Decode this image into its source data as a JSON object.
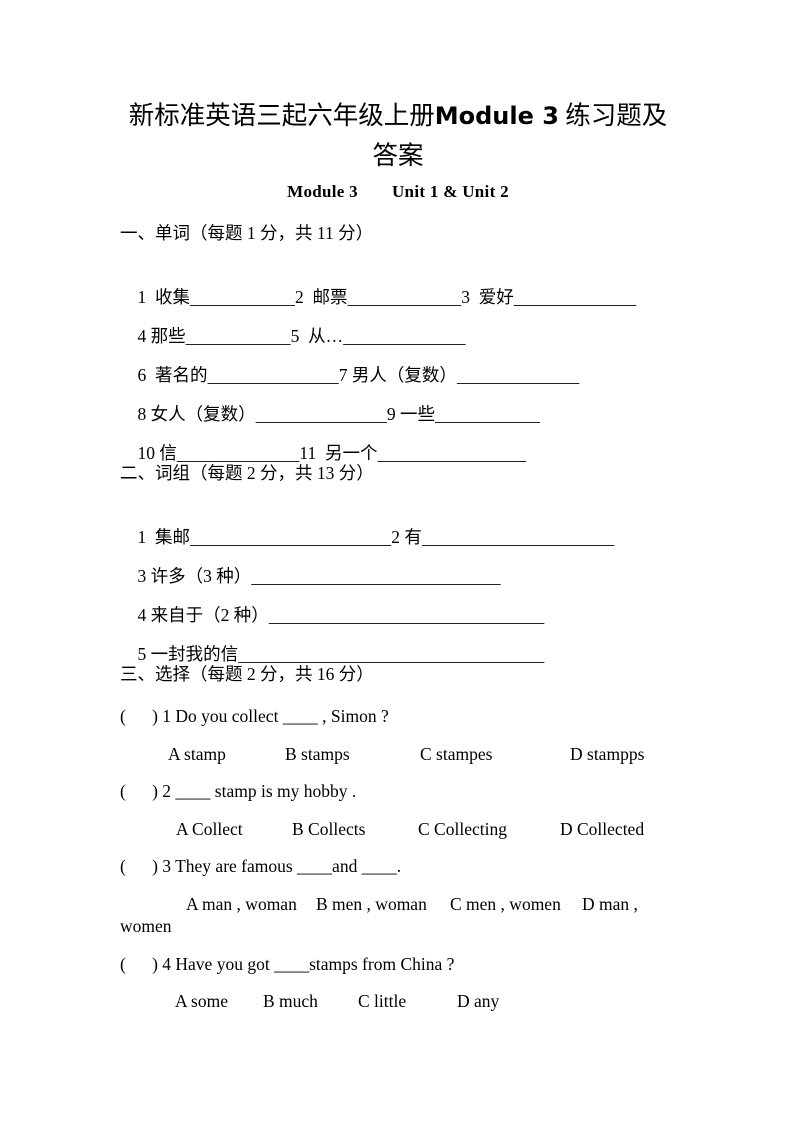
{
  "document": {
    "title_before": "新标准英语三起六年级上册 ",
    "title_bold": "Module 3",
    "title_after": " 练习题及答案",
    "title_line1": "新标准英语三起六年级上册",
    "title_line2": "案",
    "subtitle_left": "Module 3",
    "subtitle_right": "Unit 1 & Unit 2"
  },
  "section1": {
    "heading": "一、单词（每题 1 分，共 11 分）",
    "rows": [
      {
        "items": [
          {
            "label": "1  收集",
            "blank": "____________"
          },
          {
            "label": "2  邮票",
            "blank": "_____________"
          },
          {
            "label": "3  爱好",
            "blank": "______________"
          }
        ]
      },
      {
        "items": [
          {
            "label": "4 那些",
            "blank": "____________"
          },
          {
            "label": "5  从…",
            "blank": "______________"
          }
        ]
      },
      {
        "items": [
          {
            "label": "6  著名的",
            "blank": "_______________"
          },
          {
            "label": "7 男人（复数）",
            "blank": "______________"
          }
        ]
      },
      {
        "items": [
          {
            "label": "8 女人（复数）",
            "blank": "_______________"
          },
          {
            "label": "9 一些",
            "blank": "____________"
          }
        ]
      },
      {
        "items": [
          {
            "label": "10 信",
            "blank": "______________"
          },
          {
            "label": "11  另一个",
            "blank": "_________________"
          }
        ]
      }
    ]
  },
  "section2": {
    "heading": "二、词组（每题 2 分，共 13 分）",
    "rows": [
      {
        "items": [
          {
            "label": "1  集邮",
            "blank": "_______________________"
          },
          {
            "label": "2 有",
            "blank": "______________________"
          }
        ]
      },
      {
        "items": [
          {
            "label": "3 许多（3 种）",
            "blank": " ____________________________"
          }
        ]
      },
      {
        "items": [
          {
            "label": "4 来自于（2 种）",
            "blank": " _______________________________"
          }
        ]
      },
      {
        "items": [
          {
            "label": "5 一封我的信",
            "blank": "___________________________________"
          }
        ]
      }
    ]
  },
  "section3": {
    "heading": "三、选择（每题 2 分，共 16 分）",
    "questions": [
      {
        "stem": "(      ) 1 Do you collect ____ , Simon ?",
        "options": [
          "A stamp",
          "B stamps",
          "C stampes",
          "D stampps"
        ],
        "wrap": ""
      },
      {
        "stem": "(      ) 2 ____ stamp is my hobby .",
        "options": [
          "A Collect",
          "B Collects",
          "C Collecting",
          "D Collected"
        ],
        "wrap": ""
      },
      {
        "stem": "(      ) 3 They are famous ____and ____.",
        "options": [
          "A man , woman",
          "B men , woman",
          "C men , women",
          "D man ,"
        ],
        "wrap": "women"
      },
      {
        "stem": "(      ) 4 Have you got ____stamps from China ?",
        "options": [
          "A some",
          "B much",
          "C little",
          "D any"
        ],
        "wrap": ""
      }
    ]
  }
}
